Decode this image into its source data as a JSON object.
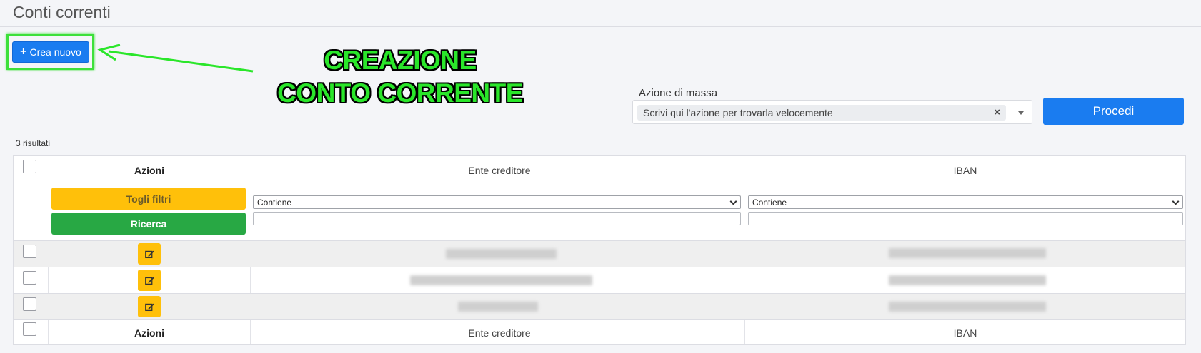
{
  "page": {
    "title": "Conti correnti"
  },
  "toolbar": {
    "create_label": "Crea nuovo"
  },
  "annotation": {
    "line1": "CREAZIONE",
    "line2": "CONTO CORRENTE",
    "color": "#2ae62a"
  },
  "mass_action": {
    "label": "Azione di massa",
    "placeholder": "Scrivi qui l'azione per trovarla velocemente",
    "clear_symbol": "×",
    "proceed_label": "Procedi"
  },
  "results": {
    "count_text": "3 risultati"
  },
  "grid": {
    "columns": [
      "Azioni",
      "Ente creditore",
      "IBAN"
    ],
    "filters": {
      "clear_label": "Togli filtri",
      "search_label": "Ricerca",
      "ente_operator": "Contiene",
      "iban_operator": "Contiene"
    },
    "footer_columns": [
      "Azioni",
      "Ente creditore",
      "IBAN"
    ]
  },
  "colors": {
    "primary": "#1a7cf0",
    "warning": "#ffc00a",
    "success": "#28a844",
    "highlight": "#3de03a"
  }
}
